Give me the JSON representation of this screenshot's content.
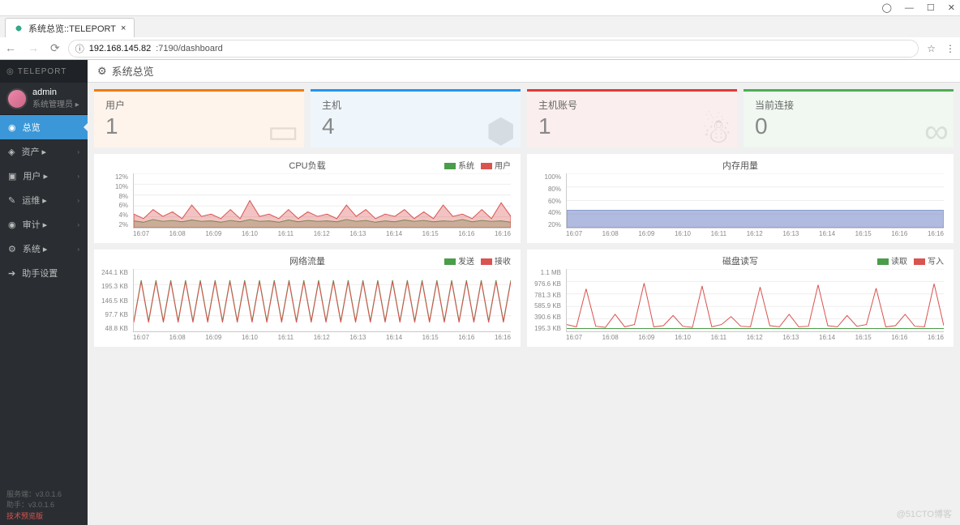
{
  "window": {
    "user_icon": "◯",
    "min": "—",
    "max": "☐",
    "close": "✕"
  },
  "browser": {
    "tab_title": "系统总览::TELEPORT",
    "url_prefix": "ⓘ",
    "url_ip": "192.168.145.82",
    "url_path": ":7190/dashboard",
    "star": "☆",
    "menu": "⋮"
  },
  "sidebar": {
    "logo": "TELEPORT",
    "user": {
      "name": "admin",
      "role": "系统管理员 ▸"
    },
    "menu": [
      {
        "icon": "◉",
        "label": "总览",
        "active": true
      },
      {
        "icon": "◈",
        "label": "资产 ▸",
        "arrow": "›"
      },
      {
        "icon": "▣",
        "label": "用户 ▸",
        "arrow": "›"
      },
      {
        "icon": "✎",
        "label": "运维 ▸",
        "arrow": "›"
      },
      {
        "icon": "◉",
        "label": "审计 ▸",
        "arrow": "›"
      },
      {
        "icon": "⚙",
        "label": "系统 ▸",
        "arrow": "›"
      },
      {
        "icon": "➔",
        "label": "助手设置"
      }
    ],
    "version": {
      "server": "服务端：v3.0.1.6",
      "assist": "助手：v3.0.1.6",
      "preview": "技术预览版"
    }
  },
  "page": {
    "title": "系统总览",
    "icon": "⚙"
  },
  "cards": [
    {
      "label": "用户",
      "value": "1",
      "cls": "orange",
      "icon": "▭"
    },
    {
      "label": "主机",
      "value": "4",
      "cls": "blue",
      "icon": "⬢"
    },
    {
      "label": "主机账号",
      "value": "1",
      "cls": "red",
      "icon": "☃"
    },
    {
      "label": "当前连接",
      "value": "0",
      "cls": "green",
      "icon": "∞"
    }
  ],
  "chart_data": [
    {
      "id": "cpu",
      "title": "CPU负载",
      "type": "area",
      "legend": [
        {
          "name": "系统",
          "cls": "lg-green"
        },
        {
          "name": "用户",
          "cls": "lg-red"
        }
      ],
      "yticks": [
        "12%",
        "10%",
        "8%",
        "6%",
        "4%",
        "2%"
      ],
      "xticks": [
        "16:07",
        "16:08",
        "16:09",
        "16:10",
        "16:11",
        "16:12",
        "16:13",
        "16:14",
        "16:15",
        "16:16",
        "16:16"
      ],
      "ylim": [
        0,
        12
      ],
      "series": [
        {
          "name": "系统",
          "color": "#4a9d4a",
          "fill": "rgba(74,157,74,.35)",
          "values": [
            1.5,
            1.2,
            1.8,
            1.4,
            1.6,
            1.3,
            1.7,
            1.4,
            1.5,
            1.2,
            1.6,
            1.3,
            1.8,
            1.4,
            1.5,
            1.2,
            1.7,
            1.3,
            1.6,
            1.4,
            1.5,
            1.3,
            1.8,
            1.4,
            1.6,
            1.2,
            1.5,
            1.3,
            1.7,
            1.4,
            1.6,
            1.3,
            1.5,
            1.4,
            1.8,
            1.3,
            1.6,
            1.4,
            1.5,
            1.2
          ]
        },
        {
          "name": "用户",
          "color": "#d9534f",
          "fill": "rgba(217,83,79,.35)",
          "values": [
            3,
            2,
            4,
            2.5,
            3.5,
            2,
            5,
            2.5,
            3,
            2,
            4,
            2,
            6,
            2.5,
            3,
            2,
            4,
            2,
            3.5,
            2.5,
            3,
            2,
            5,
            2.5,
            4,
            2,
            3,
            2.5,
            4,
            2,
            3.5,
            2,
            5,
            2.5,
            3,
            2,
            4,
            2,
            5.5,
            2.5
          ]
        }
      ]
    },
    {
      "id": "mem",
      "title": "内存用量",
      "type": "area",
      "legend": [],
      "yticks": [
        "100%",
        "80%",
        "60%",
        "40%",
        "20%"
      ],
      "xticks": [
        "16:07",
        "16:08",
        "16:09",
        "16:10",
        "16:11",
        "16:12",
        "16:13",
        "16:14",
        "16:15",
        "16:16",
        "16:16"
      ],
      "ylim": [
        0,
        100
      ],
      "series": [
        {
          "name": "mem",
          "color": "#7b8ec9",
          "fill": "rgba(123,142,201,.6)",
          "values": [
            32,
            32,
            32,
            32,
            32,
            32,
            32,
            32,
            32,
            32,
            32,
            32,
            32,
            32,
            32,
            32,
            32,
            32,
            32,
            32
          ]
        }
      ]
    },
    {
      "id": "net",
      "title": "网络流量",
      "type": "line",
      "legend": [
        {
          "name": "发送",
          "cls": "lg-green"
        },
        {
          "name": "接收",
          "cls": "lg-red"
        }
      ],
      "yticks": [
        "244.1 KB",
        "195.3 KB",
        "146.5 KB",
        "97.7 KB",
        "48.8 KB"
      ],
      "xticks": [
        "16:07",
        "16:08",
        "16:09",
        "16:10",
        "16:11",
        "16:12",
        "16:13",
        "16:14",
        "16:15",
        "16:16",
        "16:16"
      ],
      "ylim": [
        0,
        244
      ],
      "series": [
        {
          "name": "发送",
          "color": "#4a9d4a",
          "values": [
            40,
            200,
            40,
            200,
            40,
            200,
            40,
            200,
            40,
            200,
            40,
            200,
            40,
            200,
            40,
            200,
            40,
            200,
            40,
            200,
            40,
            200,
            40,
            200,
            40,
            200,
            40,
            200,
            40,
            200,
            40,
            200,
            40,
            200,
            40,
            200,
            40,
            200,
            40,
            200,
            40,
            200,
            40,
            200,
            40,
            200,
            40,
            200,
            40,
            200,
            40,
            200
          ]
        },
        {
          "name": "接收",
          "color": "#d9534f",
          "values": [
            35,
            195,
            35,
            195,
            35,
            195,
            35,
            195,
            35,
            195,
            35,
            195,
            35,
            195,
            35,
            195,
            35,
            195,
            35,
            195,
            35,
            195,
            35,
            195,
            35,
            195,
            35,
            195,
            35,
            195,
            35,
            195,
            35,
            195,
            35,
            195,
            35,
            195,
            35,
            195,
            35,
            195,
            35,
            195,
            35,
            195,
            35,
            195,
            35,
            195,
            35,
            195
          ]
        }
      ]
    },
    {
      "id": "disk",
      "title": "磁盘读写",
      "type": "line",
      "legend": [
        {
          "name": "读取",
          "cls": "lg-green"
        },
        {
          "name": "写入",
          "cls": "lg-red"
        }
      ],
      "yticks": [
        "1.1 MB",
        "976.6 KB",
        "781.3 KB",
        "585.9 KB",
        "390.6 KB",
        "195.3 KB"
      ],
      "xticks": [
        "16:07",
        "16:08",
        "16:09",
        "16:10",
        "16:11",
        "16:12",
        "16:13",
        "16:14",
        "16:15",
        "16:16",
        "16:16"
      ],
      "ylim": [
        0,
        1100
      ],
      "series": [
        {
          "name": "读取",
          "color": "#4a9d4a",
          "values": [
            50,
            50,
            50,
            50,
            50,
            50,
            50,
            50,
            50,
            50,
            50,
            50,
            50,
            50,
            50,
            50,
            50,
            50,
            50,
            50,
            50,
            50,
            50,
            50,
            50,
            50,
            50,
            50,
            50,
            50,
            50,
            50,
            50,
            50,
            50,
            50,
            50,
            50,
            50,
            50
          ]
        },
        {
          "name": "写入",
          "color": "#d9534f",
          "values": [
            120,
            80,
            750,
            90,
            70,
            300,
            80,
            120,
            850,
            80,
            100,
            280,
            90,
            70,
            800,
            80,
            120,
            260,
            90,
            80,
            780,
            100,
            80,
            300,
            80,
            90,
            820,
            100,
            80,
            280,
            90,
            120,
            760,
            80,
            100,
            300,
            90,
            80,
            840,
            100
          ]
        }
      ]
    }
  ],
  "watermark": "@51CTO博客"
}
